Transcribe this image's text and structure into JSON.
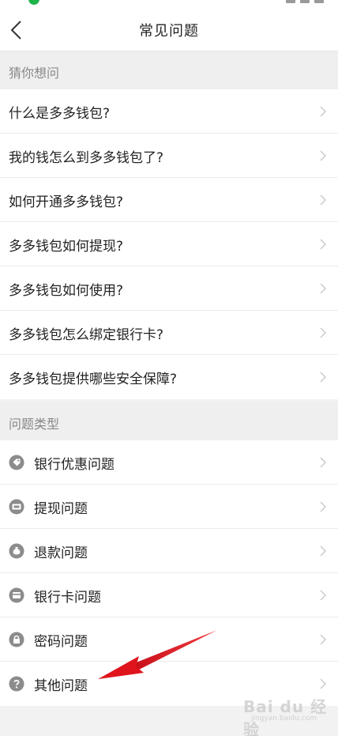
{
  "nav": {
    "title": "常见问题",
    "back_icon": "chevron-left-icon"
  },
  "section_guess": {
    "label": "猜你想问",
    "items": [
      {
        "label": "什么是多多钱包?"
      },
      {
        "label": "我的钱怎么到多多钱包了?"
      },
      {
        "label": "如何开通多多钱包?"
      },
      {
        "label": "多多钱包如何提现?"
      },
      {
        "label": "多多钱包如何使用?"
      },
      {
        "label": "多多钱包怎么绑定银行卡?"
      },
      {
        "label": "多多钱包提供哪些安全保障?"
      }
    ]
  },
  "section_types": {
    "label": "问题类型",
    "items": [
      {
        "label": "银行优惠问题",
        "icon": "tag-icon"
      },
      {
        "label": "提现问题",
        "icon": "cash-icon"
      },
      {
        "label": "退款问题",
        "icon": "money-bag-icon"
      },
      {
        "label": "银行卡问题",
        "icon": "card-icon"
      },
      {
        "label": "密码问题",
        "icon": "lock-icon"
      },
      {
        "label": "其他问题",
        "icon": "question-icon"
      }
    ]
  },
  "watermark": {
    "text": "Bai du 经验",
    "sub": "jingyan.baidu.com"
  },
  "colors": {
    "icon_gray": "#8c8c8c",
    "arrow_red": "#e8262b",
    "chevron": "#c8c8c8"
  }
}
